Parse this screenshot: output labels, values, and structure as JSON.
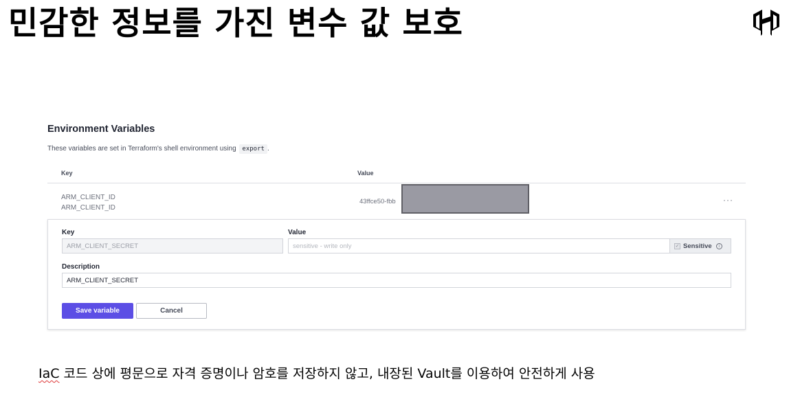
{
  "slide": {
    "title": "민감한 정보를 가진 변수 값 보호",
    "caption_lead": "IaC",
    "caption_rest": " 코드 상에 평문으로 자격 증명이나 암호를 저장하지 않고, 내장된 Vault를 이용하여 안전하게 사용"
  },
  "icons": {
    "logo": "hashicorp-logo-icon",
    "row_menu": "more-dots-icon",
    "info": "info-circle-icon",
    "checkbox": "checkbox-checked-icon"
  },
  "env": {
    "heading": "Environment Variables",
    "desc_prefix": "These variables are set in Terraform's shell environment using",
    "desc_code": "export",
    "desc_suffix": ".",
    "col_key": "Key",
    "col_value": "Value",
    "row": {
      "key": "ARM_CLIENT_ID",
      "description": "ARM_CLIENT_ID",
      "value": "43ffce50-fbb",
      "menu": "···"
    },
    "edit": {
      "key_label": "Key",
      "key_value": "ARM_CLIENT_SECRET",
      "value_label": "Value",
      "value_placeholder": "sensitive - write only",
      "sensitive_label": "Sensitive",
      "sensitive_check": "✓",
      "info_glyph": "i",
      "description_label": "Description",
      "description_value": "ARM_CLIENT_SECRET",
      "save_label": "Save variable",
      "cancel_label": "Cancel"
    }
  },
  "colors": {
    "primary_button": "#5c4ee5",
    "redaction": "#9a9aa3"
  }
}
